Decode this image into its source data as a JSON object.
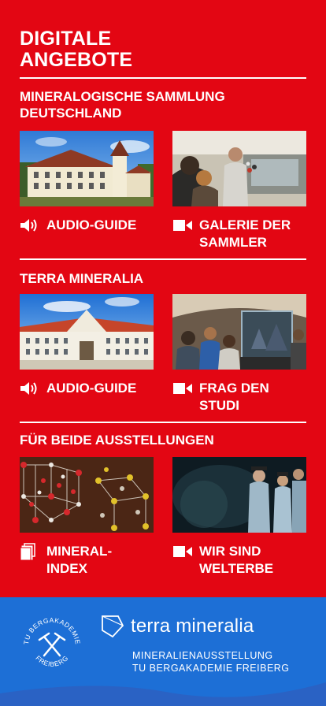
{
  "page": {
    "title_line1": "DIGITALE",
    "title_line2": "ANGEBOTE"
  },
  "sections": [
    {
      "title_line1": "MINERALOGISCHE SAMMLUNG",
      "title_line2": "DEUTSCHLAND",
      "cards": [
        {
          "icon": "speaker-icon",
          "label_line1": "AUDIO-GUIDE",
          "label_line2": ""
        },
        {
          "icon": "video-camera-icon",
          "label_line1": "GALERIE DER",
          "label_line2": "SAMMLER"
        }
      ]
    },
    {
      "title_line1": "TERRA MINERALIA",
      "cards": [
        {
          "icon": "speaker-icon",
          "label_line1": "AUDIO-GUIDE",
          "label_line2": ""
        },
        {
          "icon": "video-camera-icon",
          "label_line1": "FRAG DEN",
          "label_line2": "STUDI"
        }
      ]
    },
    {
      "title_line1": "FÜR BEIDE AUSSTELLUNGEN",
      "cards": [
        {
          "icon": "documents-icon",
          "label_line1": "MINERAL-",
          "label_line2": "INDEX"
        },
        {
          "icon": "video-camera-icon",
          "label_line1": "WIR SIND",
          "label_line2": "WELTERBE"
        }
      ]
    }
  ],
  "footer": {
    "seal_text_top": "TU BERGAKADEMIE",
    "seal_text_bottom": "FREIBERG",
    "brand_part1": "terra",
    "brand_part2": "mineralia",
    "tagline_line1": "MINERALIENAUSSTELLUNG",
    "tagline_line2": "TU BERGAKADEMIE FREIBERG"
  },
  "colors": {
    "primary_red": "#e30613",
    "footer_blue": "#1d6fd6",
    "text": "#ffffff"
  }
}
